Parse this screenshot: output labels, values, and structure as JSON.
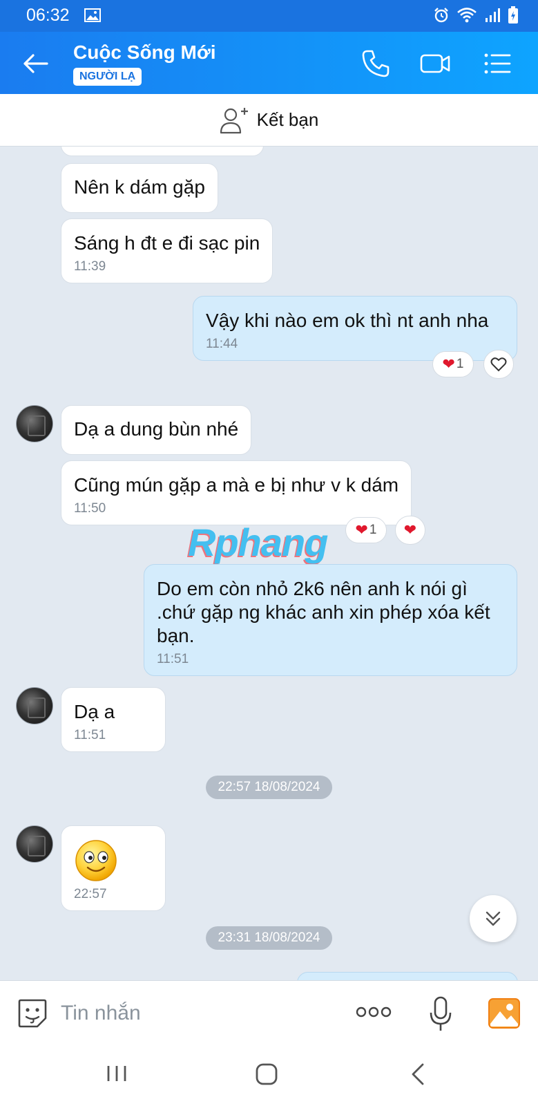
{
  "status_bar": {
    "time": "06:32"
  },
  "header": {
    "back_icon": "arrow-left-icon",
    "title": "Cuộc Sống Mới",
    "badge": "NGƯỜI LẠ",
    "icons": [
      "phone-icon",
      "video-camera-icon",
      "menu-list-icon"
    ],
    "accent": "#1a73e0"
  },
  "friend_bar": {
    "label": "Kết bạn",
    "icon": "add-friend-icon"
  },
  "messages": [
    {
      "dir": "in",
      "text": "Nên k dám gặp",
      "time": ""
    },
    {
      "dir": "in",
      "text": "Sáng h đt e đi sạc pin",
      "time": "11:39"
    },
    {
      "dir": "out",
      "text": "Vậy khi nào em ok thì nt anh nha",
      "time": "11:44",
      "reaction_count": "1"
    },
    {
      "dir": "in",
      "text": "Dạ a dung bùn nhé",
      "time": ""
    },
    {
      "dir": "in",
      "text": "Cũng mún gặp a mà e bị như v k dám",
      "time": "11:50",
      "reaction_count": "1"
    },
    {
      "dir": "out",
      "text": "Do em còn nhỏ 2k6 nên anh k nói gì .chứ gặp ng khác anh xin phép xóa kết bạn.",
      "time": "11:51"
    },
    {
      "dir": "in",
      "text": "Dạ a",
      "time": "11:51"
    },
    {
      "dir": "in",
      "text": "",
      "sticker": "smiley-emoji",
      "time": "22:57"
    }
  ],
  "date_separators": [
    "22:57 18/08/2024",
    "23:31 18/08/2024"
  ],
  "watermark": "Rphang",
  "input": {
    "placeholder": "Tin nhắn"
  },
  "colors": {
    "incoming_bubble": "#ffffff",
    "outgoing_bubble": "#d4ecfc",
    "chat_bg": "#e2e9f1",
    "heart": "#e0182d"
  }
}
